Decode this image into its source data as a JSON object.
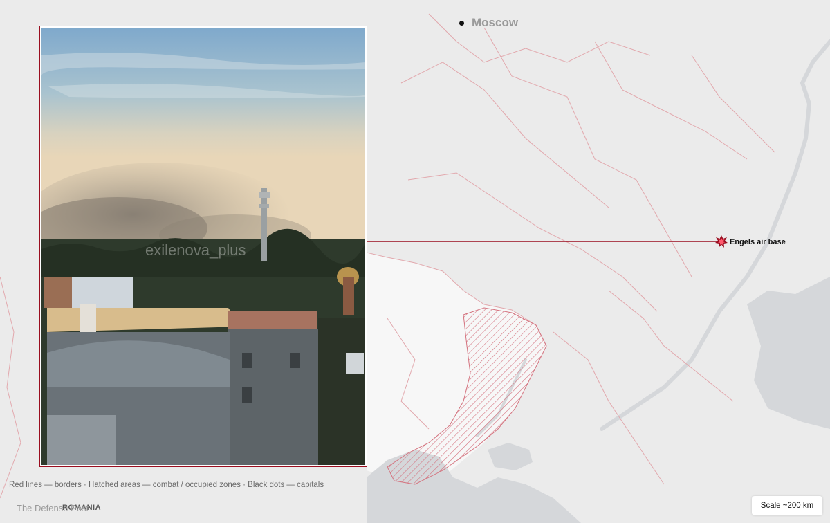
{
  "colors": {
    "land": "#ebebeb",
    "land_ukraine": "#f7f7f7",
    "water": "#d5d7da",
    "border": "#e2a8ad",
    "accent": "#9a0d1f",
    "hatch": "#d4727e",
    "text_dark": "#111111",
    "text_muted": "#9a9a9a",
    "legend_text": "#6b6b6b"
  },
  "map": {
    "cities": [
      {
        "name": "Moscow",
        "type": "capital"
      }
    ],
    "marker": {
      "label": "Engels air base",
      "icon": "explosion-icon"
    },
    "country_labels": [
      "ROMANIA"
    ]
  },
  "photo": {
    "watermark": "exilenova_plus",
    "icon": "photo-inset"
  },
  "legend": {
    "text": "Red lines — borders · Hatched areas — combat / occupied zones · Black dots — capitals"
  },
  "credit": {
    "text": "The Defense Post"
  },
  "scale": {
    "label": "Scale ~200 km"
  }
}
